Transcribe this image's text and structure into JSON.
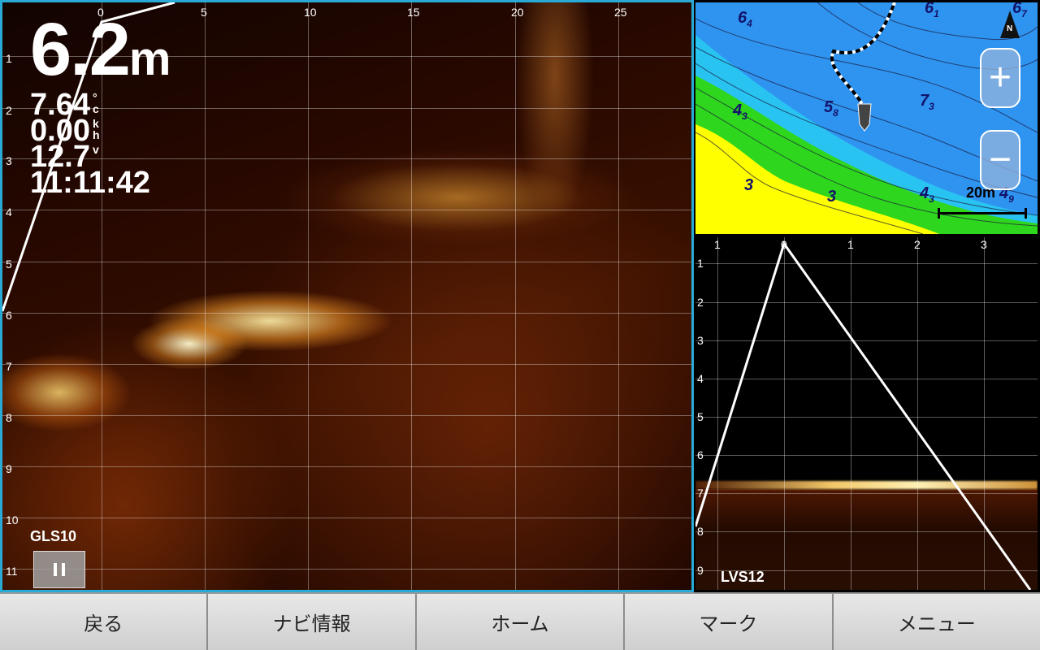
{
  "left_sonar": {
    "depth_value": "6.2",
    "depth_unit": "m",
    "temperature_value": "7.64",
    "temperature_unit": "°c",
    "speed_value": "0.00",
    "speed_unit": "kh",
    "voltage_value": "12.7",
    "voltage_unit": "v",
    "time": "11:11:42",
    "sensor_label": "GLS10",
    "x_ticks": [
      "0",
      "5",
      "10",
      "15",
      "20",
      "25"
    ],
    "y_ticks": [
      "1",
      "2",
      "3",
      "4",
      "5",
      "6",
      "7",
      "8",
      "9",
      "10",
      "11"
    ],
    "pause_icon": "pause-icon"
  },
  "map": {
    "contour_labels": [
      {
        "main": "6",
        "sub": "4"
      },
      {
        "main": "6",
        "sub": "1"
      },
      {
        "main": "6",
        "sub": "7"
      },
      {
        "main": "4",
        "sub": "3"
      },
      {
        "main": "5",
        "sub": "8"
      },
      {
        "main": "7",
        "sub": "3"
      },
      {
        "main": "3",
        "sub": ""
      },
      {
        "main": "3",
        "sub": ""
      },
      {
        "main": "4",
        "sub": "3"
      },
      {
        "main": "4",
        "sub": "9"
      }
    ],
    "scale_label": "20m",
    "zoom_in_label": "+",
    "zoom_out_label": "−",
    "north_icon": "north-arrow-icon",
    "north_letter": "N",
    "colors": {
      "deep": "#2f93f0",
      "mid": "#29c3f2",
      "shallow_green": "#2fd61e",
      "shallow_yellow": "#ffff00",
      "contour": "#1a1a3a"
    }
  },
  "right_sonar": {
    "x_ticks": [
      "1",
      "0",
      "1",
      "2",
      "3"
    ],
    "y_ticks": [
      "1",
      "2",
      "3",
      "4",
      "5",
      "6",
      "7",
      "8",
      "9"
    ],
    "sensor_label": "LVS12"
  },
  "bottom_bar": {
    "back": "戻る",
    "nav_info": "ナビ情報",
    "home": "ホーム",
    "mark": "マーク",
    "menu": "メニュー"
  }
}
